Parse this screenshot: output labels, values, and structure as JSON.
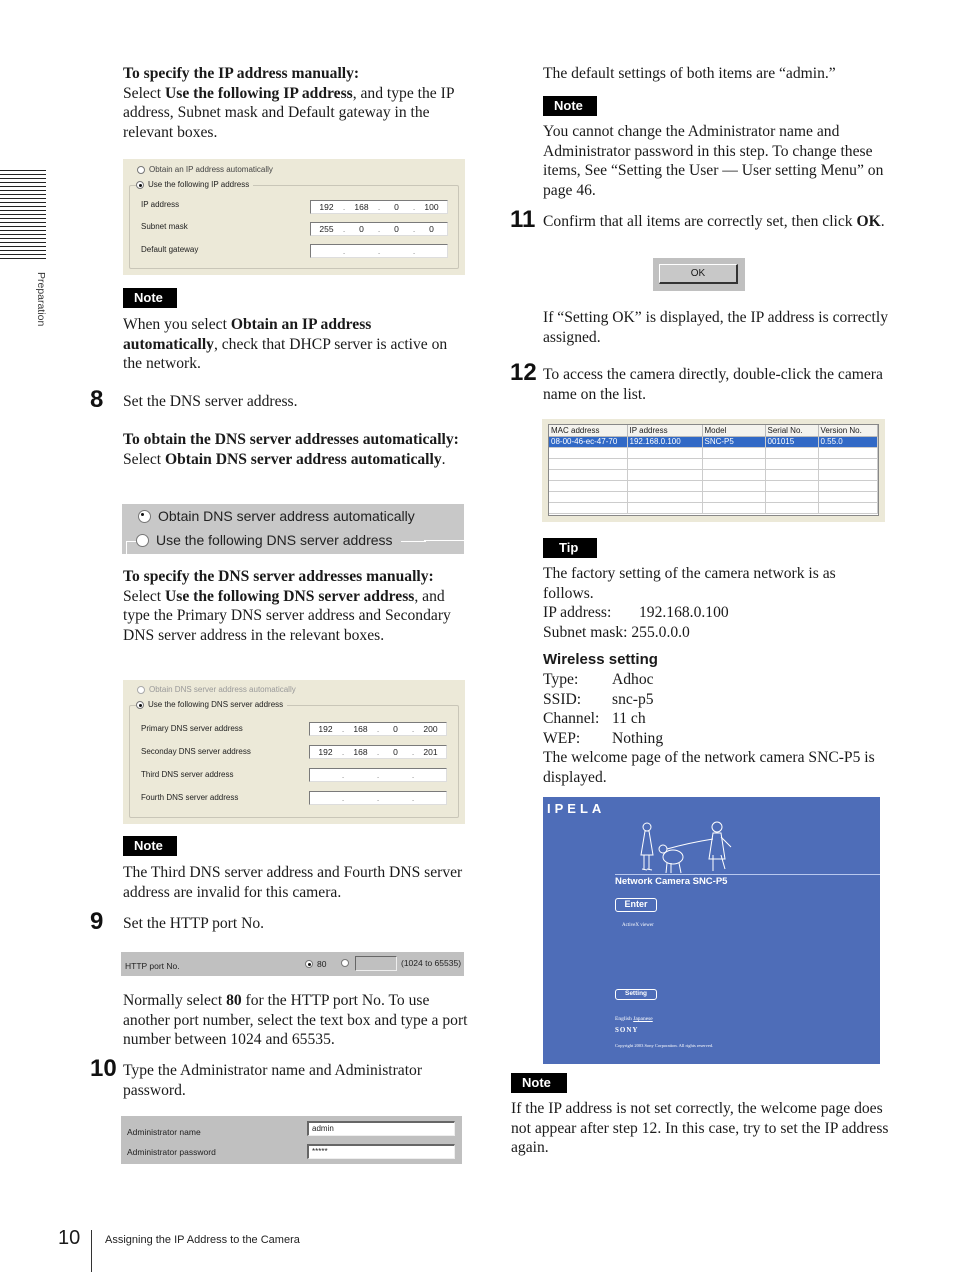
{
  "side_tab": {
    "label": "Preparation"
  },
  "left": {
    "manual_ip": {
      "heading": "To specify the IP address manually:",
      "pre": "Select ",
      "bold": "Use the following IP address",
      "post": ", and type the IP address, Subnet mask and Default gateway in the relevant boxes."
    },
    "ip_dialog": {
      "radio_auto": "Obtain an IP address automatically",
      "radio_manual": "Use the following IP address",
      "selected": "manual",
      "fields": [
        {
          "label": "IP address",
          "octets": [
            "192",
            "168",
            "0",
            "100"
          ]
        },
        {
          "label": "Subnet mask",
          "octets": [
            "255",
            "0",
            "0",
            "0"
          ]
        },
        {
          "label": "Default gateway",
          "octets": [
            "",
            "",
            "",
            ""
          ]
        }
      ]
    },
    "note1": {
      "badge": "Note",
      "pre": "When you select ",
      "bold": "Obtain an IP address automatically",
      "post": ", check that DHCP server is active on the network."
    },
    "step8": {
      "num": "8",
      "text": "Set the DNS server address.",
      "auto_heading": "To obtain the DNS server addresses automatically:",
      "auto_pre": "Select ",
      "auto_bold": "Obtain DNS server address automatically",
      "auto_post": "."
    },
    "dns_auto_dialog": {
      "radio_auto": "Obtain DNS server address automatically",
      "radio_manual": "Use the following DNS server address",
      "selected": "auto"
    },
    "manual_dns": {
      "heading": "To specify the DNS server addresses manually:",
      "pre": "Select ",
      "bold": "Use the following DNS server address",
      "post": ", and type the Primary DNS server address and Secondary DNS server address in the relevant boxes."
    },
    "dns_dialog": {
      "radio_auto": "Obtain DNS server address automatically",
      "radio_manual": "Use the following DNS server address",
      "selected": "manual",
      "fields": [
        {
          "label": "Primary DNS server address",
          "octets": [
            "192",
            "168",
            "0",
            "200"
          ]
        },
        {
          "label": "Seconday DNS server address",
          "octets": [
            "192",
            "168",
            "0",
            "201"
          ]
        },
        {
          "label": "Third DNS server address",
          "octets": [
            "",
            "",
            "",
            ""
          ]
        },
        {
          "label": "Fourth DNS server address",
          "octets": [
            "",
            "",
            "",
            ""
          ]
        }
      ]
    },
    "note2": {
      "badge": "Note",
      "text": "The Third DNS server address and Fourth DNS server address are invalid for this camera."
    },
    "step9": {
      "num": "9",
      "text": "Set the HTTP port No."
    },
    "http_dialog": {
      "label": "HTTP port No.",
      "option_default": "80",
      "selected": "80",
      "custom_value": "",
      "range_hint": "(1024 to 65535)"
    },
    "http_para": {
      "pre": "Normally select ",
      "bold": "80",
      "post": " for the HTTP port No.  To use another port number, select the text box and type a port number between 1024 and 65535."
    },
    "step10": {
      "num": "10",
      "text": "Type the Administrator name and Administrator password."
    },
    "admin_dialog": {
      "name_label": "Administrator name",
      "name_value": "admin",
      "password_label": "Administrator password",
      "password_value": "*****"
    }
  },
  "right": {
    "default_text": "The default settings of both items are “admin.”",
    "note3": {
      "badge": "Note",
      "text": "You cannot change the Administrator name and Administrator password in this step.  To change these items, See “Setting the User — User setting Menu” on page 46."
    },
    "step11": {
      "num": "11",
      "pre": "Confirm that all items are correctly set, then click ",
      "bold": "OK",
      "post": "."
    },
    "ok_button": "OK",
    "setting_ok_text": "If “Setting OK” is displayed, the IP address is correctly assigned.",
    "step12": {
      "num": "12",
      "text": "To access the camera directly, double-click the camera name on the list."
    },
    "camera_list": {
      "columns": [
        "MAC address",
        "IP address",
        "Model",
        "Serial No.",
        "Version No."
      ],
      "rows": [
        [
          "08-00-46-ec-47-70",
          "192.168.0.100",
          "SNC-P5",
          "001015",
          "0.55.0"
        ]
      ],
      "empty_rows": 6,
      "selected_row": 0
    },
    "tip": {
      "badge": "Tip",
      "intro": "The factory setting of the camera network is as follows.",
      "ip_label": "IP address:",
      "ip_value": "192.168.0.100",
      "mask_label": "Subnet mask:",
      "mask_value": "255.0.0.0",
      "wireless_heading": "Wireless setting",
      "wireless": [
        {
          "label": "Type:",
          "value": "Adhoc"
        },
        {
          "label": "SSID:",
          "value": "snc-p5"
        },
        {
          "label": "Channel:",
          "value": "11 ch"
        },
        {
          "label": "WEP:",
          "value": "Nothing"
        }
      ],
      "outro": "The welcome page of the network camera SNC-P5 is displayed."
    },
    "welcome_page": {
      "logo": "IPELA",
      "title": "Network Camera SNC-P5",
      "enter_button": "Enter",
      "viewer_label": "ActiveX viewer",
      "setting_button": "Setting",
      "lang_english": "English",
      "lang_japanese": "Japanese",
      "brand": "SONY",
      "copyright": "Copyright 2003 Sony Corporation. All rights reserved.",
      "bg_color": "#4e6db8"
    },
    "note4": {
      "badge": "Note",
      "text": "If the IP address is not set correctly, the welcome page does not appear after step 12. In this case, try to set the IP address again."
    }
  },
  "footer": {
    "page_number": "10",
    "section_title": "Assigning the IP Address to the Camera"
  }
}
